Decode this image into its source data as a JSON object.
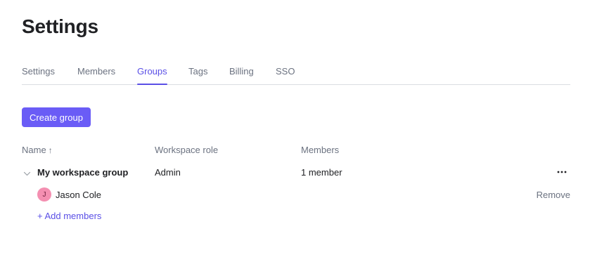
{
  "page": {
    "title": "Settings"
  },
  "tabs": [
    {
      "label": "Settings",
      "active": false
    },
    {
      "label": "Members",
      "active": false
    },
    {
      "label": "Groups",
      "active": true
    },
    {
      "label": "Tags",
      "active": false
    },
    {
      "label": "Billing",
      "active": false
    },
    {
      "label": "SSO",
      "active": false
    }
  ],
  "actions": {
    "create_group_label": "Create group"
  },
  "table": {
    "columns": {
      "name": "Name",
      "sort_indicator": "↑",
      "role": "Workspace role",
      "members": "Members"
    },
    "group": {
      "name": "My workspace group",
      "role": "Admin",
      "member_count": "1 member",
      "more_icon": "more-horizontal-icon",
      "members": [
        {
          "initial": "J",
          "name": "Jason Cole",
          "remove_label": "Remove"
        }
      ],
      "add_members_label": "+ Add members"
    }
  },
  "colors": {
    "accent": "#6a5cf6",
    "accent_text": "#5a4fe6",
    "muted_text": "#6b7280",
    "avatar_bg": "#f48fb1"
  }
}
